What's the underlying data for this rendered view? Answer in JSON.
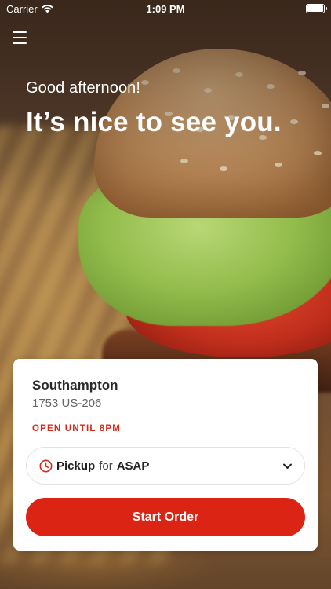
{
  "status_bar": {
    "carrier": "Carrier",
    "time": "1:09 PM",
    "icons": [
      "wifi-icon",
      "battery-icon"
    ]
  },
  "header": {
    "menu_icon": "hamburger-menu-icon"
  },
  "greeting": {
    "salutation": "Good afternoon!",
    "headline": "It’s nice to see you."
  },
  "store": {
    "name": "Southampton",
    "address": "1753 US-206",
    "hours": "OPEN UNTIL 8PM"
  },
  "order_options": {
    "method": "Pickup",
    "connector": "for",
    "time": "ASAP",
    "icon": "clock-icon",
    "expand_icon": "chevron-down-icon"
  },
  "actions": {
    "start_order_label": "Start Order"
  },
  "colors": {
    "accent": "#dc2414",
    "card_background": "#ffffff",
    "text_primary": "#2a2a2a",
    "text_secondary": "#666666"
  }
}
